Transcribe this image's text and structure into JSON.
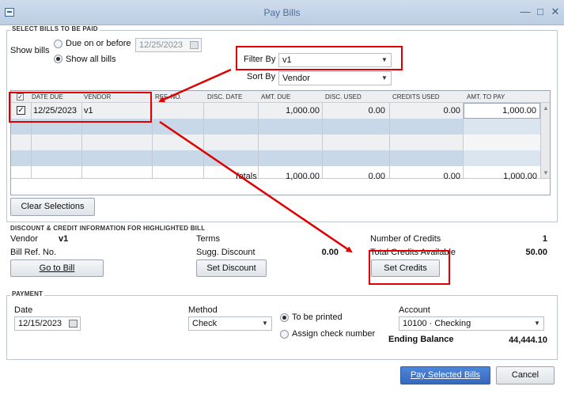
{
  "window": {
    "title": "Pay Bills"
  },
  "select_section": {
    "heading": "SELECT BILLS TO BE PAID",
    "show_bills_label": "Show bills",
    "option_due": "Due on or before",
    "option_all": "Show all bills",
    "selected_option": "Show all bills",
    "due_date": "12/25/2023",
    "filter_by_label": "Filter By",
    "filter_by_value": "v1",
    "sort_by_label": "Sort By",
    "sort_by_value": "Vendor"
  },
  "table": {
    "columns": [
      "DATE DUE",
      "VENDOR",
      "REF. NO.",
      "DISC. DATE",
      "AMT. DUE",
      "DISC. USED",
      "CREDITS USED",
      "AMT. TO PAY"
    ],
    "rows": [
      {
        "checked": true,
        "date_due": "12/25/2023",
        "vendor": "v1",
        "ref_no": "",
        "disc_date": "",
        "amt_due": "1,000.00",
        "disc_used": "0.00",
        "credits_used": "0.00",
        "amt_to_pay": "1,000.00"
      }
    ],
    "totals": {
      "label": "Totals",
      "amt_due": "1,000.00",
      "disc_used": "0.00",
      "credits_used": "0.00",
      "amt_to_pay": "1,000.00"
    }
  },
  "clear_selections_label": "Clear Selections",
  "discount_section": {
    "heading": "DISCOUNT & CREDIT INFORMATION FOR HIGHLIGHTED BILL",
    "vendor_label": "Vendor",
    "vendor_value": "v1",
    "bill_ref_label": "Bill Ref. No.",
    "terms_label": "Terms",
    "sugg_discount_label": "Sugg. Discount",
    "sugg_discount_value": "0.00",
    "num_credits_label": "Number of Credits",
    "num_credits_value": "1",
    "total_credits_label": "Total Credits Available",
    "total_credits_value": "50.00",
    "go_to_bill_label": "Go to Bill",
    "set_discount_label": "Set Discount",
    "set_credits_label": "Set Credits"
  },
  "payment_section": {
    "heading": "PAYMENT",
    "date_label": "Date",
    "date_value": "12/15/2023",
    "method_label": "Method",
    "method_value": "Check",
    "to_be_printed_label": "To be printed",
    "assign_check_label": "Assign check number",
    "selected_print_option": "To be printed",
    "account_label": "Account",
    "account_value": "10100 · Checking",
    "ending_balance_label": "Ending Balance",
    "ending_balance_value": "44,444.10"
  },
  "footer": {
    "pay_selected_label": "Pay Selected Bills",
    "cancel_label": "Cancel"
  },
  "colors": {
    "title_bar": "#c5d5e8",
    "row_stripe": "#c8d8e8",
    "primary_button": "#3c74c9",
    "annotation_red": "#e00000"
  }
}
